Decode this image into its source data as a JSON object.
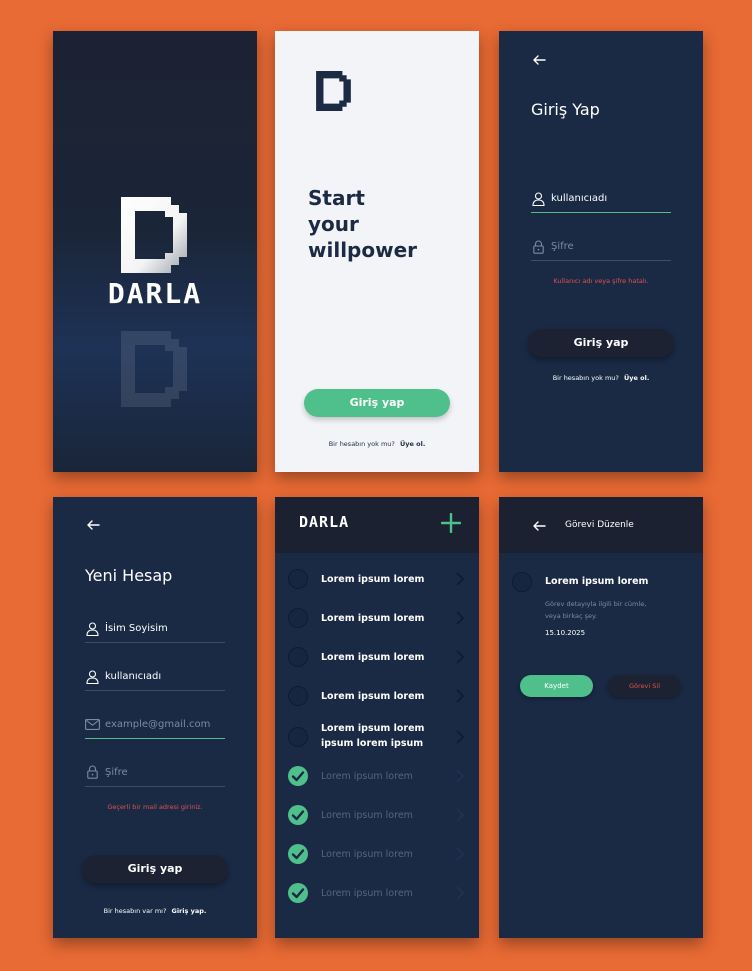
{
  "colors": {
    "background": "#e86a34",
    "navy": "#1a2a45",
    "dark_header": "#1b2131",
    "accent_green": "#4fbf8c",
    "error_red": "#e05050",
    "light_bg": "#f3f4f7"
  },
  "splash": {
    "logo_text": "DARLA"
  },
  "welcome": {
    "headline": [
      "Start",
      "your",
      "willpower"
    ],
    "login_button": "Giriş yap",
    "signup_prompt": "Bir hesabın yok mu?",
    "signup_link": "Üye ol."
  },
  "login": {
    "title": "Giriş Yap",
    "username_value": "kullanıcıadı",
    "password_placeholder": "Şifre",
    "error": "Kullanıcı adı veya şifre hatalı.",
    "submit": "Giriş yap",
    "signup_prompt": "Bir hesabın yok mu?",
    "signup_link": "Üye ol."
  },
  "register": {
    "title": "Yeni Hesap",
    "name_value": "İsim Soyisim",
    "username_value": "kullanıcıadı",
    "email_placeholder": "example@gmail.com",
    "password_placeholder": "Şifre",
    "error": "Geçerli bir mail adresi giriniz.",
    "submit": "Giriş yap",
    "login_prompt": "Bir hesabın var mı?",
    "login_link": "Giriş yap."
  },
  "tasks": {
    "app_title": "DARLA",
    "add_icon": "plus-icon",
    "items": [
      {
        "text": "Lorem ipsum lorem",
        "done": false
      },
      {
        "text": "Lorem ipsum lorem",
        "done": false
      },
      {
        "text": "Lorem ipsum lorem",
        "done": false
      },
      {
        "text": "Lorem ipsum lorem",
        "done": false
      },
      {
        "text": "Lorem ipsum lorem ipsum lorem ipsum",
        "done": false
      },
      {
        "text": "Lorem ipsum lorem",
        "done": true
      },
      {
        "text": "Lorem ipsum lorem",
        "done": true
      },
      {
        "text": "Lorem ipsum lorem",
        "done": true
      },
      {
        "text": "Lorem ipsum lorem",
        "done": true
      }
    ]
  },
  "edit": {
    "title": "Görevi Düzenle",
    "task_title": "Lorem ipsum lorem",
    "description": "Görev detayıyla ilgili bir cümle, veya birkaç şey.",
    "date": "15.10.2025",
    "save": "Kaydet",
    "delete": "Görevi Sil"
  }
}
